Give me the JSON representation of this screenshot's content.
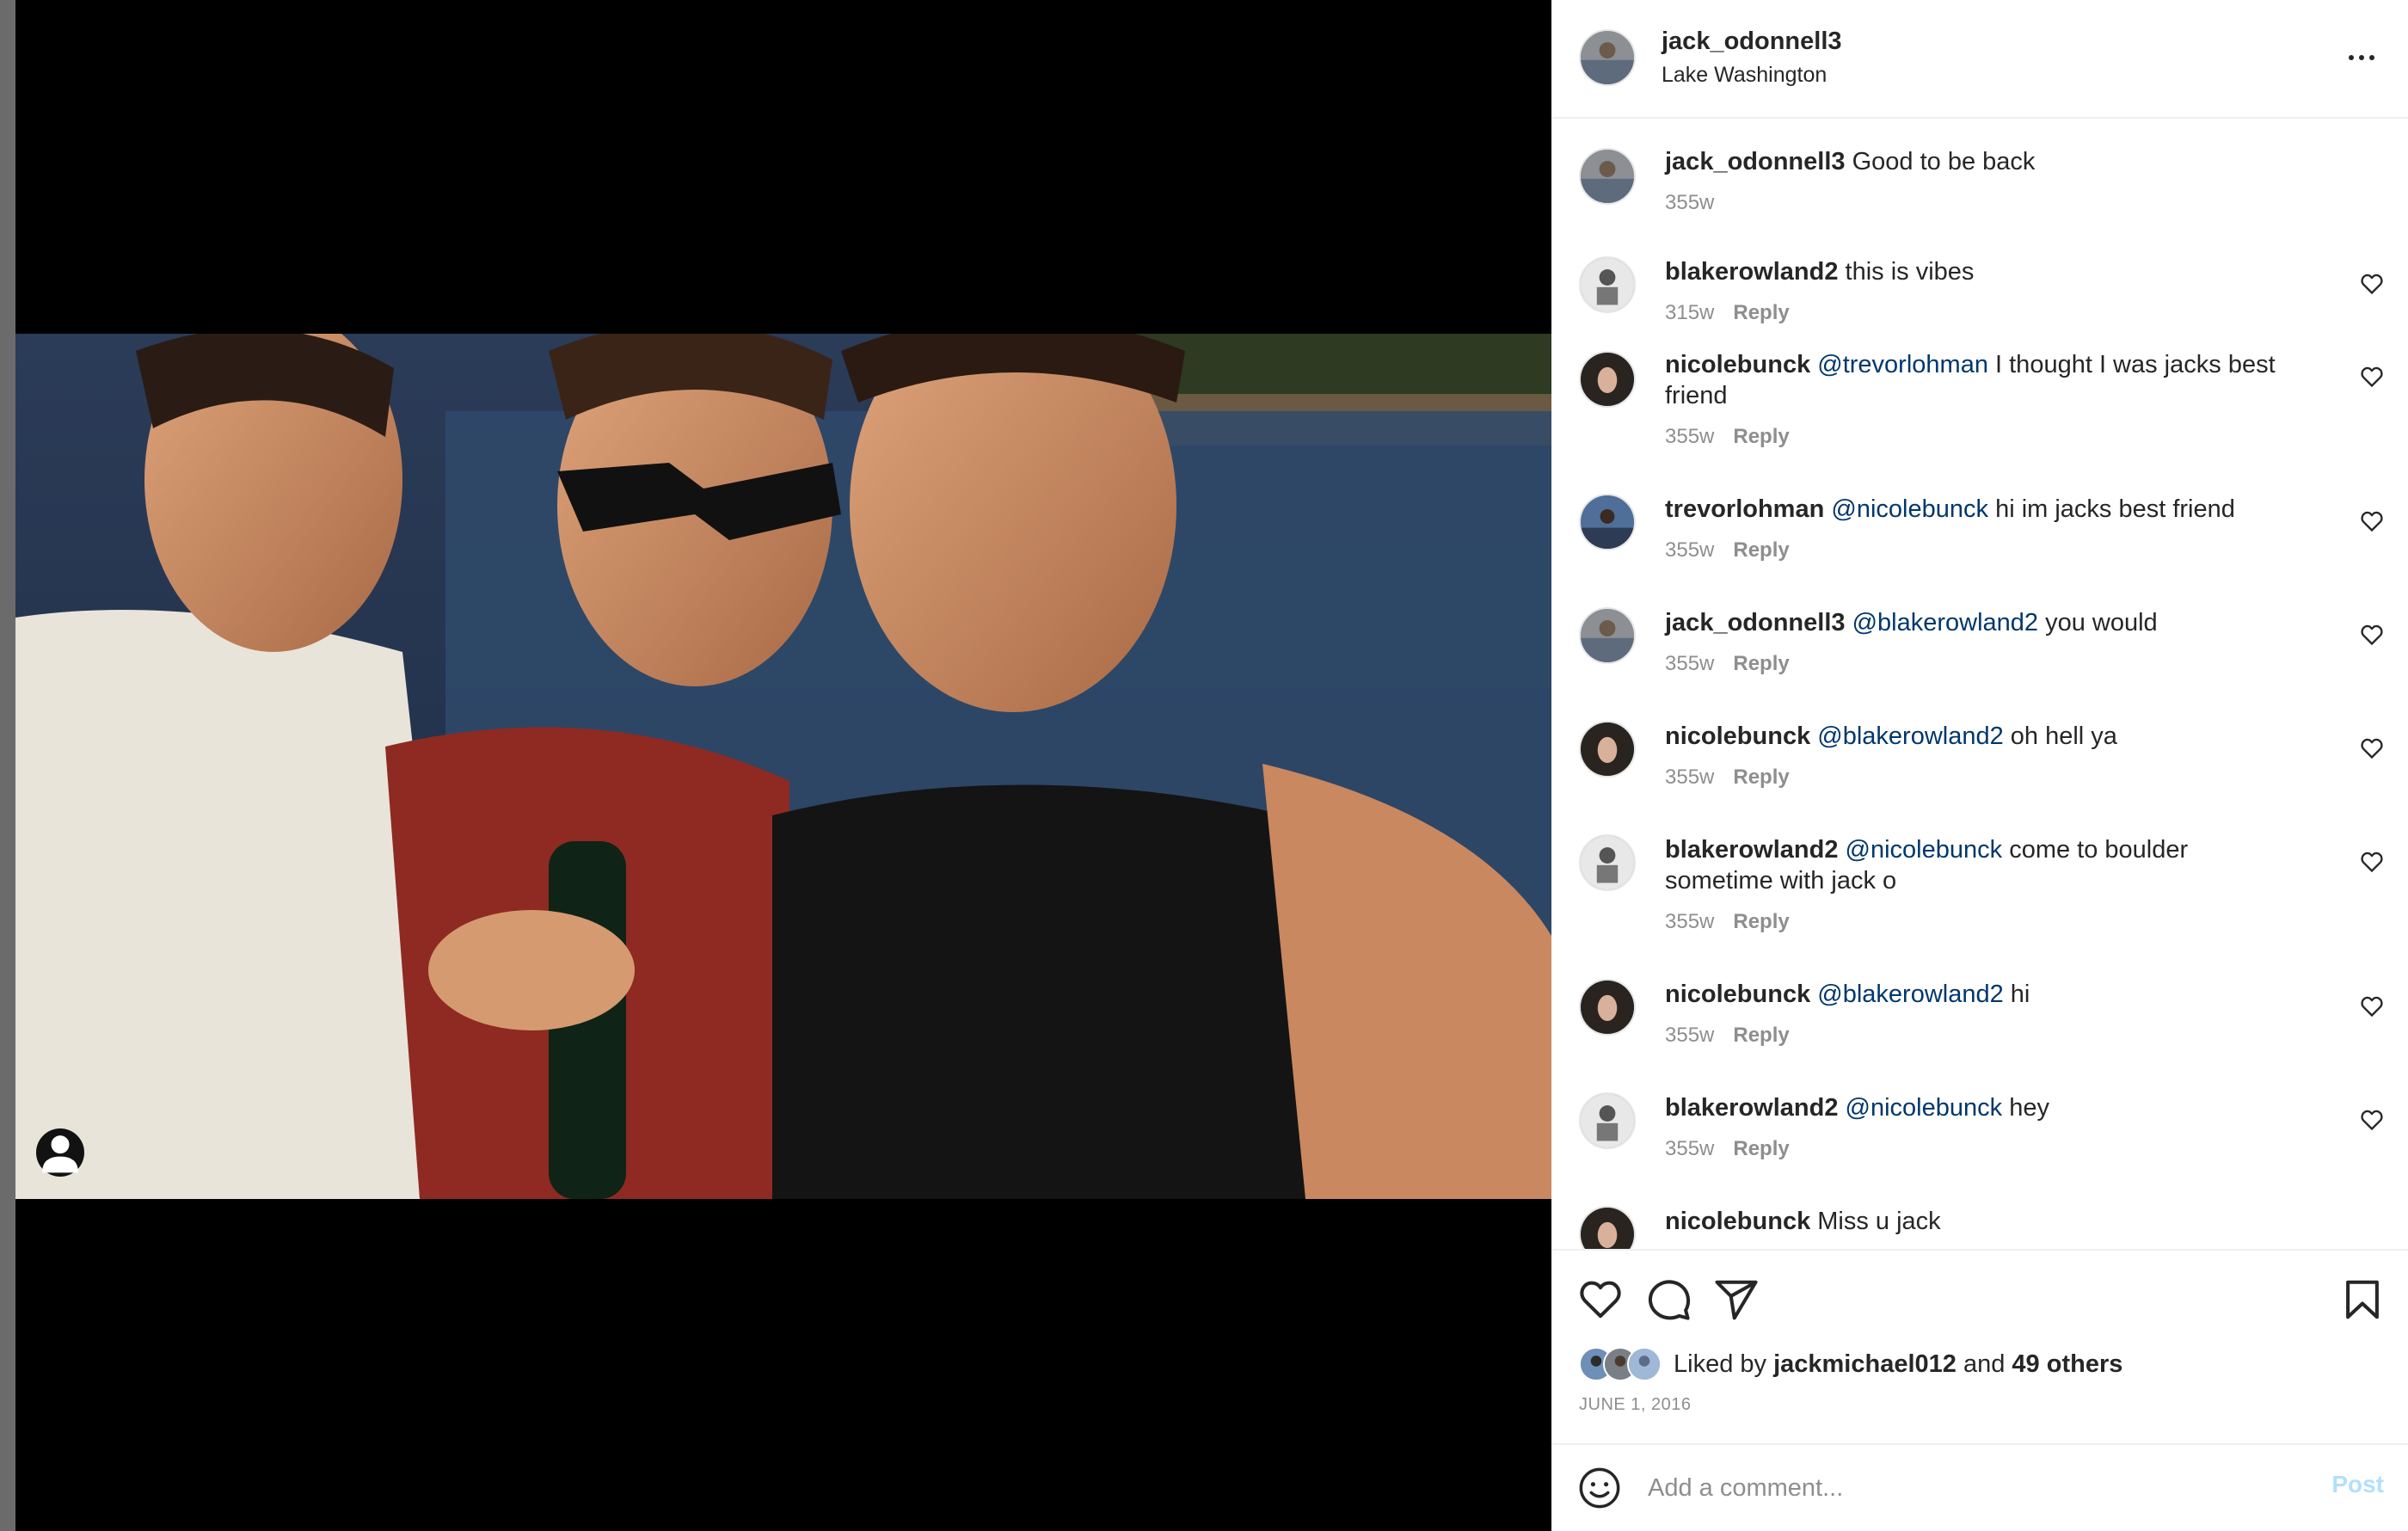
{
  "post": {
    "username": "jack_odonnell3",
    "location": "Lake Washington"
  },
  "comments": [
    {
      "user": "jack_odonnell3",
      "mention": "",
      "text": "Good to be back",
      "time": "355w",
      "reply": ""
    },
    {
      "user": "blakerowland2",
      "mention": "",
      "text": "this is vibes",
      "time": "315w",
      "reply": "Reply"
    },
    {
      "user": "nicolebunck",
      "mention": "@trevorlohman",
      "text": "I thought I was jacks best friend",
      "time": "355w",
      "reply": "Reply"
    },
    {
      "user": "trevorlohman",
      "mention": "@nicolebunck",
      "text": "hi im jacks best friend",
      "time": "355w",
      "reply": "Reply"
    },
    {
      "user": "jack_odonnell3",
      "mention": "@blakerowland2",
      "text": "you would",
      "time": "355w",
      "reply": "Reply"
    },
    {
      "user": "nicolebunck",
      "mention": "@blakerowland2",
      "text": "oh hell ya",
      "time": "355w",
      "reply": "Reply"
    },
    {
      "user": "blakerowland2",
      "mention": "@nicolebunck",
      "text": "come to boulder sometime with jack o",
      "time": "355w",
      "reply": "Reply"
    },
    {
      "user": "nicolebunck",
      "mention": "@blakerowland2",
      "text": "hi",
      "time": "355w",
      "reply": "Reply"
    },
    {
      "user": "blakerowland2",
      "mention": "@nicolebunck",
      "text": "hey",
      "time": "355w",
      "reply": "Reply"
    },
    {
      "user": "nicolebunck",
      "mention": "",
      "text": "Miss u jack",
      "time": "",
      "reply": ""
    }
  ],
  "likes": {
    "prefix": "Liked by",
    "user": "jackmichael012",
    "and": "and",
    "others": "49 others"
  },
  "date": "JUNE 1, 2016",
  "composer": {
    "placeholder": "Add a comment...",
    "post_label": "Post"
  },
  "icons": {
    "more": "more-options-icon",
    "like": "heart-icon",
    "comment": "comment-icon",
    "share": "share-icon",
    "save": "bookmark-icon",
    "emoji": "emoji-icon",
    "tag": "user-tag-icon"
  },
  "colors": {
    "mention": "#00376b",
    "muted": "#8e8e8e",
    "post_disabled": "#b2dffc"
  }
}
